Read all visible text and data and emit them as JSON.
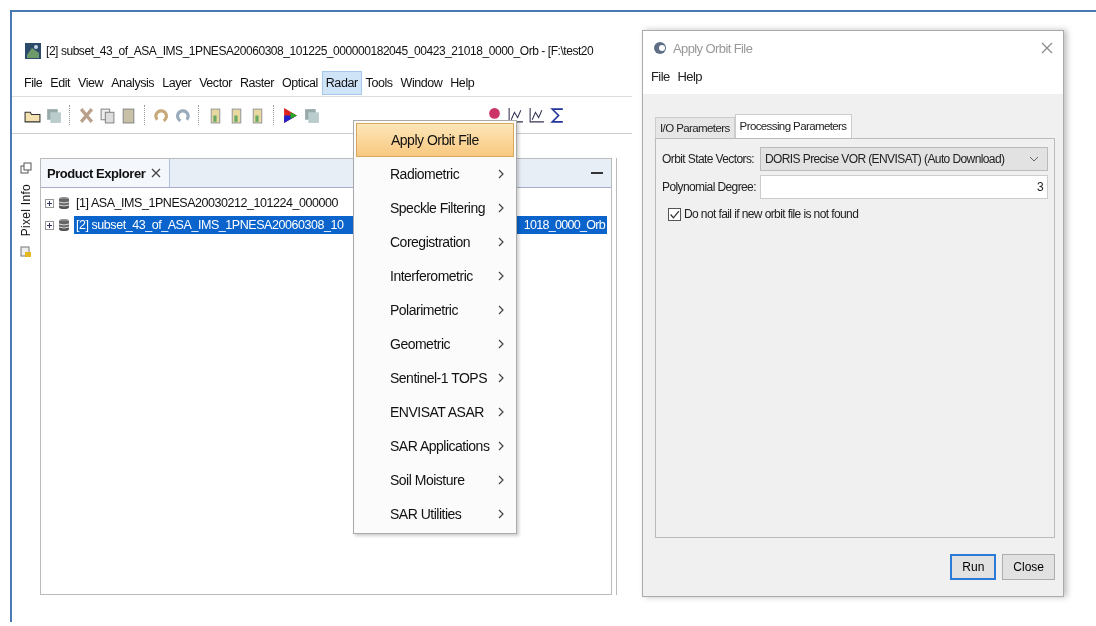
{
  "main_window": {
    "title": "[2] subset_43_of_ASA_IMS_1PNESA20060308_101225_000000182045_00423_21018_0000_Orb - [F:\\test20",
    "menu_bar": [
      {
        "label": "File",
        "selected": false
      },
      {
        "label": "Edit",
        "selected": false
      },
      {
        "label": "View",
        "selected": false
      },
      {
        "label": "Analysis",
        "selected": false
      },
      {
        "label": "Layer",
        "selected": false
      },
      {
        "label": "Vector",
        "selected": false
      },
      {
        "label": "Raster",
        "selected": false
      },
      {
        "label": "Optical",
        "selected": false
      },
      {
        "label": "Radar",
        "selected": true
      },
      {
        "label": "Tools",
        "selected": false
      },
      {
        "label": "Window",
        "selected": false
      },
      {
        "label": "Help",
        "selected": false
      }
    ],
    "side_strip": {
      "label": "Pixel Info"
    },
    "product_explorer": {
      "tab": "Product Explorer",
      "products": [
        {
          "label": "[1] ASA_IMS_1PNESA20030212_101224_000000",
          "selected": false
        },
        {
          "label": "[2] subset_43_of_ASA_IMS_1PNESA20060308_10",
          "label_end": "1018_0000_Orb",
          "selected": true
        }
      ]
    },
    "radar_menu": {
      "items": [
        {
          "label": "Apply Orbit File",
          "submenu": false,
          "selected": true
        },
        {
          "label": "Radiometric",
          "submenu": true,
          "selected": false
        },
        {
          "label": "Speckle Filtering",
          "submenu": true,
          "selected": false
        },
        {
          "label": "Coregistration",
          "submenu": true,
          "selected": false
        },
        {
          "label": "Interferometric",
          "submenu": true,
          "selected": false
        },
        {
          "label": "Polarimetric",
          "submenu": true,
          "selected": false
        },
        {
          "label": "Geometric",
          "submenu": true,
          "selected": false
        },
        {
          "label": "Sentinel-1 TOPS",
          "submenu": true,
          "selected": false
        },
        {
          "label": "ENVISAT ASAR",
          "submenu": true,
          "selected": false
        },
        {
          "label": "SAR Applications",
          "submenu": true,
          "selected": false
        },
        {
          "label": "Soil Moisture",
          "submenu": true,
          "selected": false
        },
        {
          "label": "SAR Utilities",
          "submenu": true,
          "selected": false
        }
      ]
    }
  },
  "dialog": {
    "title": "Apply Orbit File",
    "menu_bar": [
      "File",
      "Help"
    ],
    "tabs": [
      {
        "label": "I/O Parameters",
        "selected": false
      },
      {
        "label": "Processing Parameters",
        "selected": true
      }
    ],
    "fields": [
      {
        "kind": "dropdown",
        "label": "Orbit State Vectors:",
        "value": "DORIS Precise VOR (ENVISAT) (Auto Download)"
      },
      {
        "kind": "text",
        "label": "Polynomial Degree:",
        "value": "3"
      }
    ],
    "checkbox": {
      "label": "Do not fail if new orbit file is not found",
      "checked": true
    },
    "buttons": [
      {
        "label": "Run",
        "focused": true
      },
      {
        "label": "Close",
        "focused": false
      }
    ]
  }
}
